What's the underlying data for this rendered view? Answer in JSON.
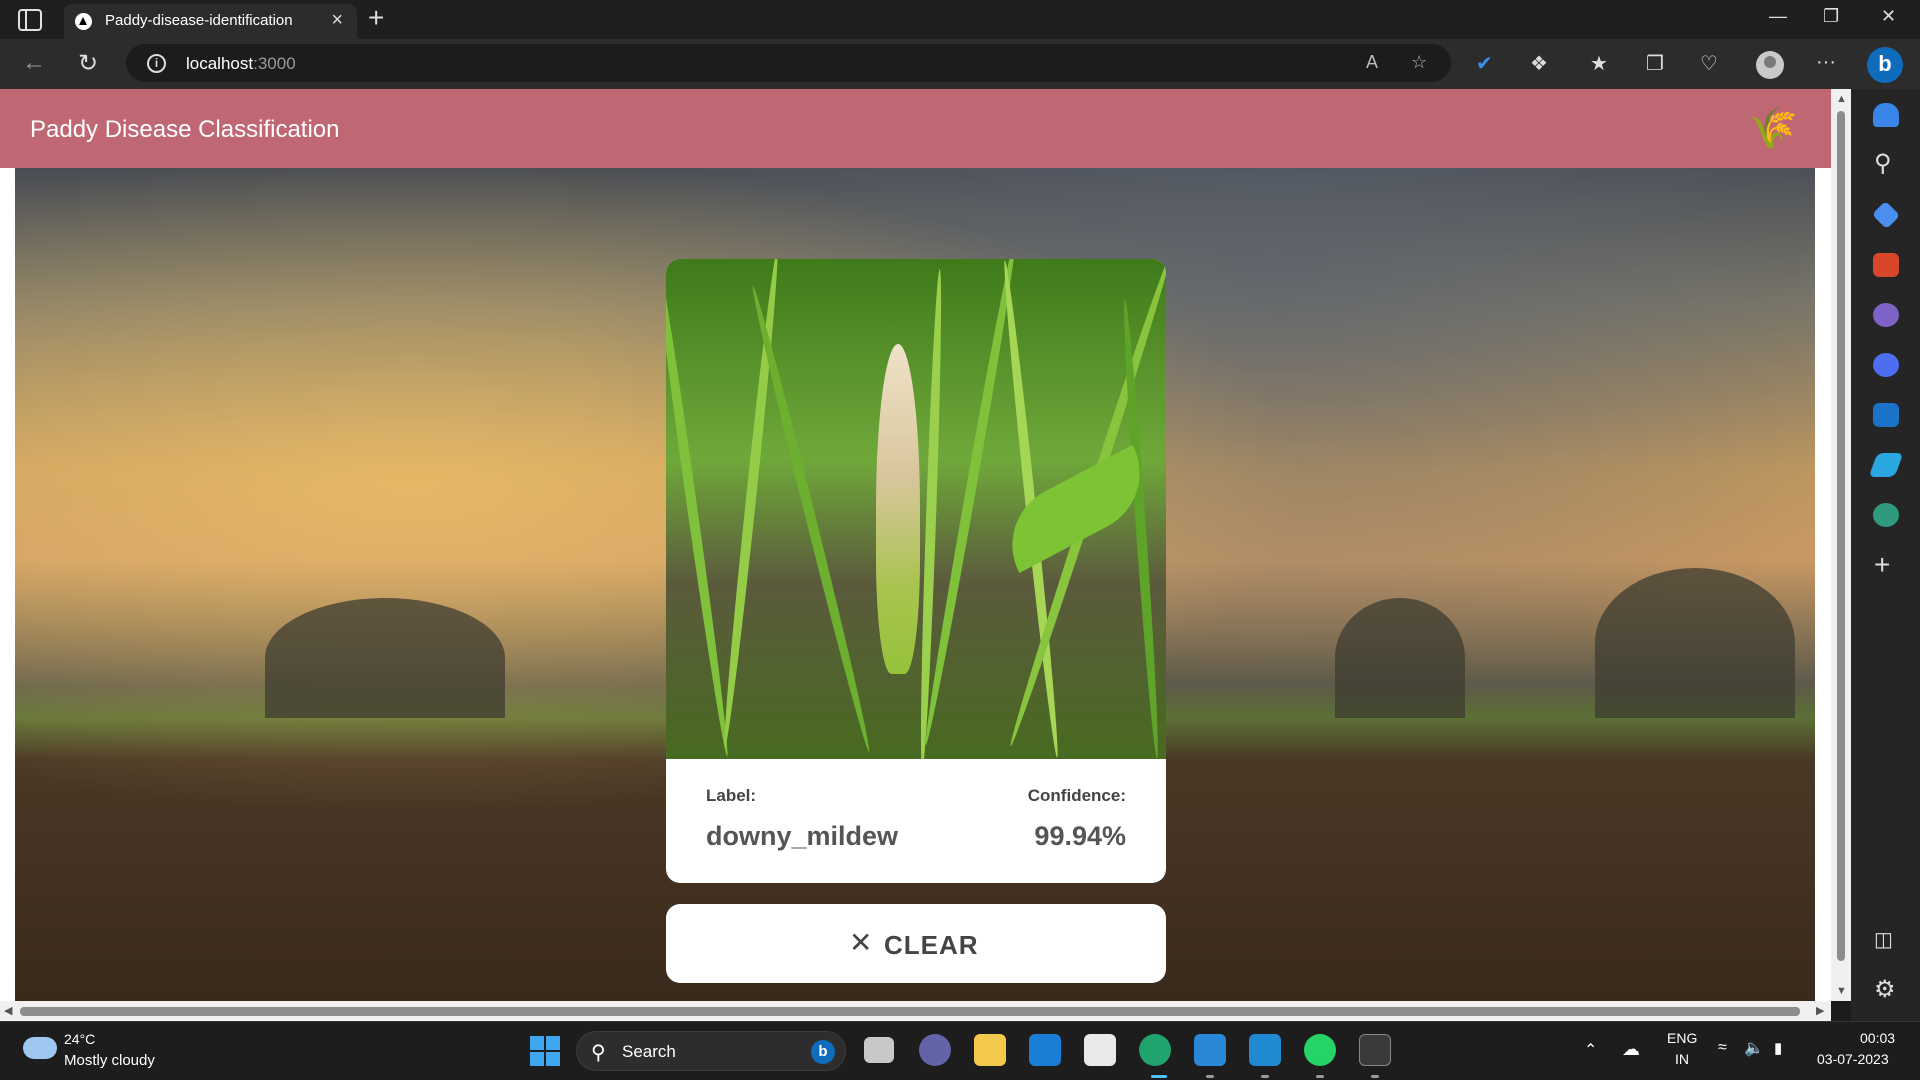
{
  "browser": {
    "tab_title": "Paddy-disease-identification",
    "tab_close": "×",
    "new_tab": "+",
    "url_host": "localhost",
    "url_port": ":3000",
    "read_aloud": "A",
    "more": "···",
    "window_controls": [
      "—",
      "❐",
      "✕"
    ]
  },
  "app": {
    "title": "Paddy Disease Classification",
    "logo_icon": "wheat-icon"
  },
  "prediction": {
    "label_heading": "Label:",
    "label_value": "downy_mildew",
    "confidence_heading": "Confidence:",
    "confidence_value": "99.94%"
  },
  "clear_button": {
    "icon": "✕",
    "label": "CLEAR"
  },
  "taskbar": {
    "weather_temp": "24°C",
    "weather_condition": "Mostly cloudy",
    "search_placeholder": "Search",
    "lang_top": "ENG",
    "lang_bottom": "IN",
    "time": "00:03",
    "date": "03-07-2023"
  },
  "colors": {
    "app_bar": "#c06774",
    "card_bg": "#ffffff",
    "browser_dark": "#2c2c2c"
  }
}
